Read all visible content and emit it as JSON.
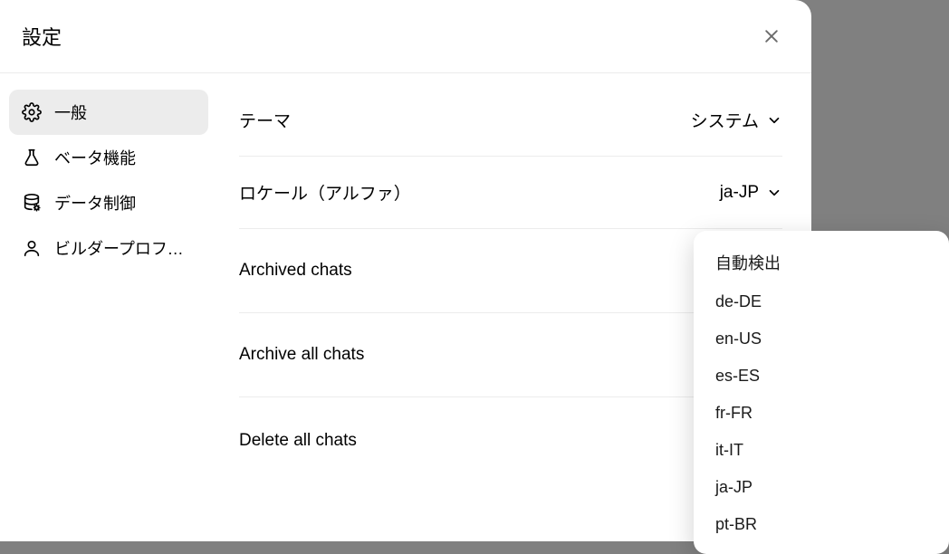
{
  "modal": {
    "title": "設定"
  },
  "sidebar": {
    "items": [
      {
        "label": "一般"
      },
      {
        "label": "ベータ機能"
      },
      {
        "label": "データ制御"
      },
      {
        "label": "ビルダープロフィ…"
      }
    ]
  },
  "settings": {
    "theme": {
      "label": "テーマ",
      "value": "システム"
    },
    "locale": {
      "label": "ロケール（アルファ）",
      "value": "ja-JP"
    },
    "archived": {
      "label": "Archived chats"
    },
    "archive_all": {
      "label": "Archive all chats"
    },
    "delete_all": {
      "label": "Delete all chats"
    }
  },
  "locale_dropdown": {
    "options": [
      "自動検出",
      "de-DE",
      "en-US",
      "es-ES",
      "fr-FR",
      "it-IT",
      "ja-JP",
      "pt-BR"
    ]
  }
}
